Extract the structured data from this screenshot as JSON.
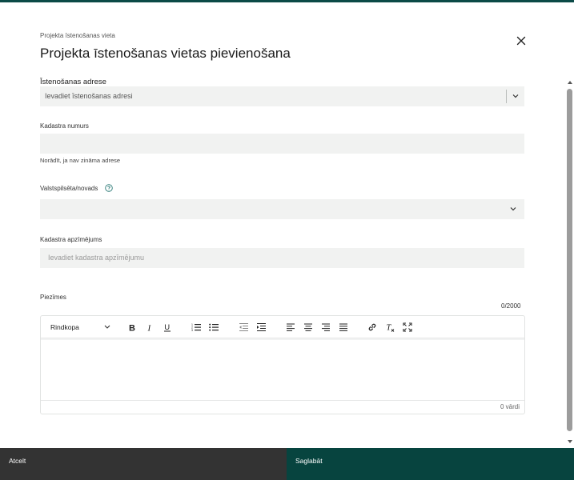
{
  "dialog": {
    "breadcrumb": "Projekta īstenošanas vieta",
    "title": "Projekta īstenošanas vietas pievienošana",
    "close_icon": "close-icon"
  },
  "form": {
    "address": {
      "label": "Īstenošanas adrese",
      "placeholder": "Ievadiet īstenošanas adresi"
    },
    "cadastre_number": {
      "label": "Kadastra numurs",
      "value": "",
      "hint": "Norādīt, ja nav zināma adrese"
    },
    "municipality": {
      "label": "Valstspilsēta/novads",
      "value": ""
    },
    "cadastre_designation": {
      "label": "Kadastra apzīmējums",
      "placeholder": "Ievadiet kadastra apzīmējumu"
    },
    "notes": {
      "label": "Piezīmes",
      "counter": "0/2000",
      "format_value": "Rindkopa",
      "word_count": "0 vārdi",
      "toolbar_icons": [
        "bold-icon",
        "italic-icon",
        "underline-icon",
        "numbered-list-icon",
        "bulleted-list-icon",
        "outdent-icon",
        "indent-icon",
        "align-left-icon",
        "align-center-icon",
        "align-right-icon",
        "justify-icon",
        "link-icon",
        "clear-format-icon",
        "fullscreen-icon"
      ]
    }
  },
  "footer": {
    "cancel_label": "Atcelt",
    "save_label": "Saglabāt"
  },
  "colors": {
    "accent": "#07443f",
    "cancel_bg": "#333333",
    "field_bg": "#f1f2f1"
  }
}
